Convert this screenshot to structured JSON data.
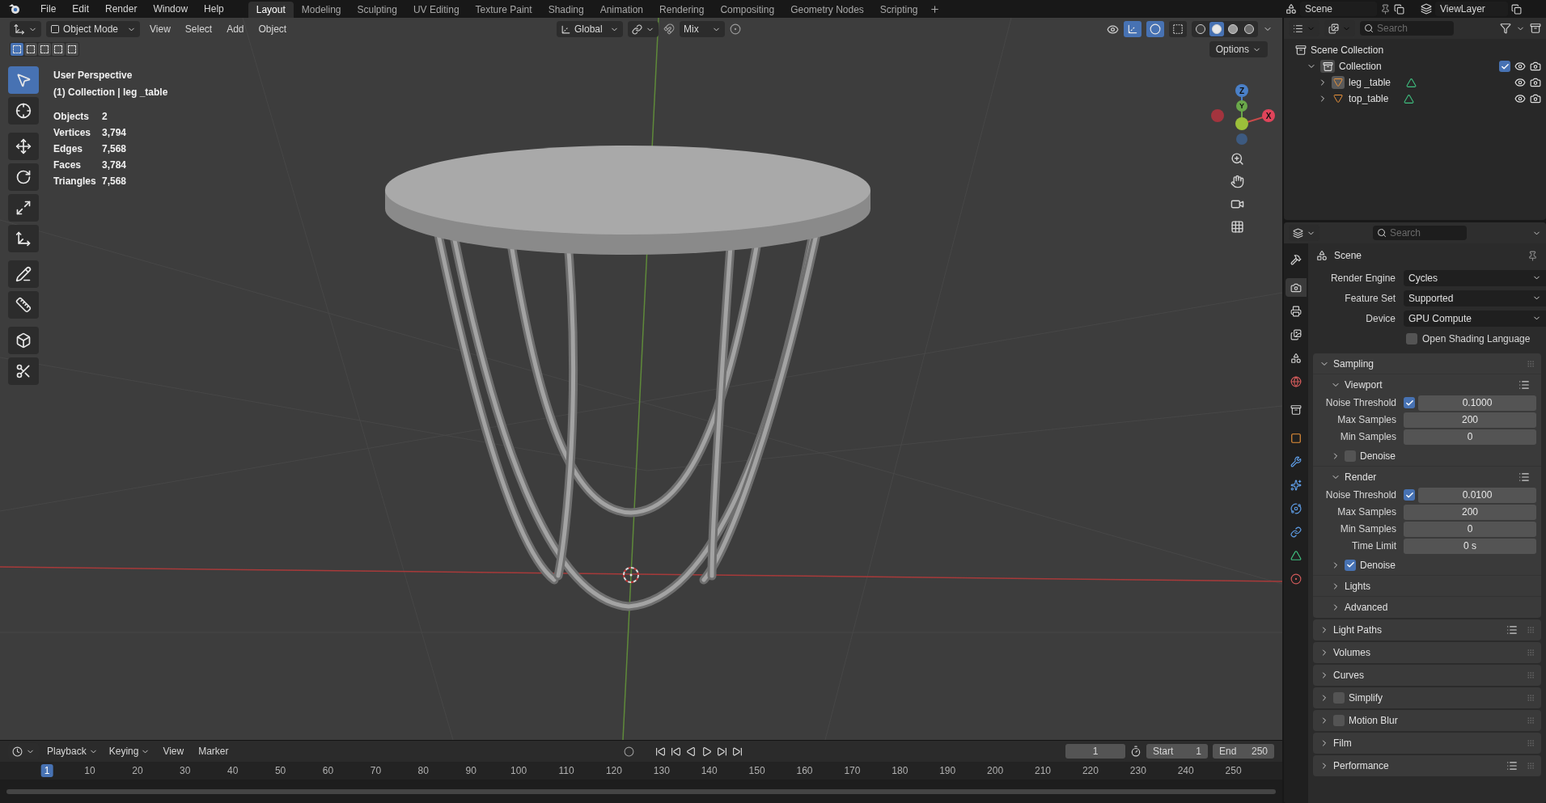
{
  "menu": [
    "File",
    "Edit",
    "Render",
    "Window",
    "Help"
  ],
  "workspaces": [
    {
      "label": "Layout",
      "selected": true
    },
    {
      "label": "Modeling",
      "selected": false
    },
    {
      "label": "Sculpting",
      "selected": false
    },
    {
      "label": "UV Editing",
      "selected": false
    },
    {
      "label": "Texture Paint",
      "selected": false
    },
    {
      "label": "Shading",
      "selected": false
    },
    {
      "label": "Animation",
      "selected": false
    },
    {
      "label": "Rendering",
      "selected": false
    },
    {
      "label": "Compositing",
      "selected": false
    },
    {
      "label": "Geometry Nodes",
      "selected": false
    },
    {
      "label": "Scripting",
      "selected": false
    }
  ],
  "top_right": {
    "scene": "Scene",
    "view_layer": "ViewLayer"
  },
  "viewport_header": {
    "mode": "Object Mode",
    "menus": [
      "View",
      "Select",
      "Add",
      "Object"
    ],
    "orientation": "Global",
    "snap": "Mix",
    "options": "Options",
    "toggles": [
      {
        "kind": "gizmo",
        "on": true
      },
      {
        "kind": "overlay",
        "on": true
      },
      {
        "kind": "xray",
        "on": false
      }
    ],
    "shading_modes": [
      {
        "kind": "wireframe",
        "selected": false
      },
      {
        "kind": "solid",
        "selected": true
      },
      {
        "kind": "material",
        "selected": false
      },
      {
        "kind": "rendered",
        "selected": false
      }
    ]
  },
  "select_modes": [
    {
      "selected": true
    },
    {
      "selected": false
    },
    {
      "selected": false
    },
    {
      "selected": false
    },
    {
      "selected": false
    }
  ],
  "tools": [
    {
      "kind": "select",
      "selected": true
    },
    {
      "kind": "cursor",
      "selected": false
    },
    {
      "kind": "move",
      "selected": false
    },
    {
      "kind": "rotate",
      "selected": false
    },
    {
      "kind": "scale",
      "selected": false
    },
    {
      "kind": "transform",
      "selected": false
    },
    {
      "kind": "annotate",
      "selected": false
    },
    {
      "kind": "measure",
      "selected": false
    },
    {
      "kind": "add-cube",
      "selected": false
    },
    {
      "kind": "knife",
      "selected": false
    }
  ],
  "overlay": {
    "view": "User Perspective",
    "context": "(1) Collection | leg _table",
    "stats": [
      {
        "label": "Objects",
        "value": "2"
      },
      {
        "label": "Vertices",
        "value": "3,794"
      },
      {
        "label": "Edges",
        "value": "7,568"
      },
      {
        "label": "Faces",
        "value": "3,784"
      },
      {
        "label": "Triangles",
        "value": "7,568"
      }
    ]
  },
  "gizmo": {
    "x": "X",
    "y": "Y",
    "z": "Z"
  },
  "outliner": {
    "search": {
      "placeholder": "Search"
    },
    "tree": [
      {
        "label": "Scene Collection",
        "kind": "scene-collection",
        "children": [
          {
            "label": "Collection",
            "kind": "collection",
            "expanded": true,
            "checked": true,
            "children": [
              {
                "label": "leg _table",
                "kind": "mesh",
                "expanded": false,
                "selected": true
              },
              {
                "label": "top_table",
                "kind": "mesh",
                "expanded": false,
                "selected": false
              }
            ]
          }
        ]
      }
    ]
  },
  "properties": {
    "search": {
      "placeholder": "Search"
    },
    "tabs": [
      {
        "kind": "tool",
        "selected": false
      },
      {
        "kind": "render",
        "selected": true
      },
      {
        "kind": "output",
        "selected": false
      },
      {
        "kind": "view-layer",
        "selected": false
      },
      {
        "kind": "scene",
        "selected": false
      },
      {
        "kind": "world",
        "selected": false
      },
      {
        "kind": "collection",
        "selected": false
      },
      {
        "kind": "object",
        "selected": false
      },
      {
        "kind": "modifiers",
        "selected": false
      },
      {
        "kind": "particles",
        "selected": false
      },
      {
        "kind": "physics",
        "selected": false
      },
      {
        "kind": "constraints",
        "selected": false
      },
      {
        "kind": "data",
        "selected": false
      },
      {
        "kind": "material",
        "selected": false
      }
    ],
    "context": "Scene",
    "fields": [
      {
        "label": "Render Engine",
        "value": "Cycles"
      },
      {
        "label": "Feature Set",
        "value": "Supported"
      },
      {
        "label": "Device",
        "value": "GPU Compute"
      }
    ],
    "osl": {
      "label": "Open Shading Language",
      "checked": false
    },
    "panels": [
      {
        "label": "Sampling",
        "expanded": true,
        "children": [
          {
            "label": "Viewport",
            "expanded": true,
            "presets": true,
            "rows": [
              {
                "kind": "toggle-number",
                "label": "Noise Threshold",
                "checked": true,
                "value": "0.1000"
              },
              {
                "kind": "number",
                "label": "Max Samples",
                "value": "200"
              },
              {
                "kind": "number",
                "label": "Min Samples",
                "value": "0"
              }
            ],
            "children": [
              {
                "label": "Denoise",
                "expanded": false,
                "checked": false
              }
            ]
          },
          {
            "label": "Render",
            "expanded": true,
            "presets": true,
            "rows": [
              {
                "kind": "toggle-number",
                "label": "Noise Threshold",
                "checked": true,
                "value": "0.0100"
              },
              {
                "kind": "number",
                "label": "Max Samples",
                "value": "200"
              },
              {
                "kind": "number",
                "label": "Min Samples",
                "value": "0"
              },
              {
                "kind": "number",
                "label": "Time Limit",
                "value": "0 s"
              }
            ],
            "children": [
              {
                "label": "Denoise",
                "expanded": false,
                "checked": true
              }
            ]
          },
          {
            "label": "Lights",
            "expanded": false
          },
          {
            "label": "Advanced",
            "expanded": false
          }
        ]
      },
      {
        "label": "Light Paths",
        "expanded": false,
        "presets": true
      },
      {
        "label": "Volumes",
        "expanded": false
      },
      {
        "label": "Curves",
        "expanded": false
      },
      {
        "label": "Simplify",
        "expanded": false,
        "checked": false
      },
      {
        "label": "Motion Blur",
        "expanded": false,
        "checked": false
      },
      {
        "label": "Film",
        "expanded": false
      },
      {
        "label": "Performance",
        "expanded": false,
        "presets": true
      }
    ]
  },
  "timeline": {
    "menus": [
      {
        "label": "Playback",
        "kind": "dropdown"
      },
      {
        "label": "Keying",
        "kind": "dropdown"
      },
      {
        "label": "View",
        "kind": "plain"
      },
      {
        "label": "Marker",
        "kind": "plain"
      }
    ],
    "current_frame": "1",
    "start": {
      "label": "Start",
      "value": "1"
    },
    "end": {
      "label": "End",
      "value": "250"
    },
    "ruler": [
      {
        "label": "1",
        "selected": true
      },
      {
        "label": "10",
        "selected": false
      },
      {
        "label": "20",
        "selected": false
      },
      {
        "label": "30",
        "selected": false
      },
      {
        "label": "40",
        "selected": false
      },
      {
        "label": "50",
        "selected": false
      },
      {
        "label": "60",
        "selected": false
      },
      {
        "label": "70",
        "selected": false
      },
      {
        "label": "80",
        "selected": false
      },
      {
        "label": "90",
        "selected": false
      },
      {
        "label": "100",
        "selected": false
      },
      {
        "label": "110",
        "selected": false
      },
      {
        "label": "120",
        "selected": false
      },
      {
        "label": "130",
        "selected": false
      },
      {
        "label": "140",
        "selected": false
      },
      {
        "label": "150",
        "selected": false
      },
      {
        "label": "160",
        "selected": false
      },
      {
        "label": "170",
        "selected": false
      },
      {
        "label": "180",
        "selected": false
      },
      {
        "label": "190",
        "selected": false
      },
      {
        "label": "200",
        "selected": false
      },
      {
        "label": "210",
        "selected": false
      },
      {
        "label": "220",
        "selected": false
      },
      {
        "label": "230",
        "selected": false
      },
      {
        "label": "240",
        "selected": false
      },
      {
        "label": "250",
        "selected": false
      }
    ]
  }
}
